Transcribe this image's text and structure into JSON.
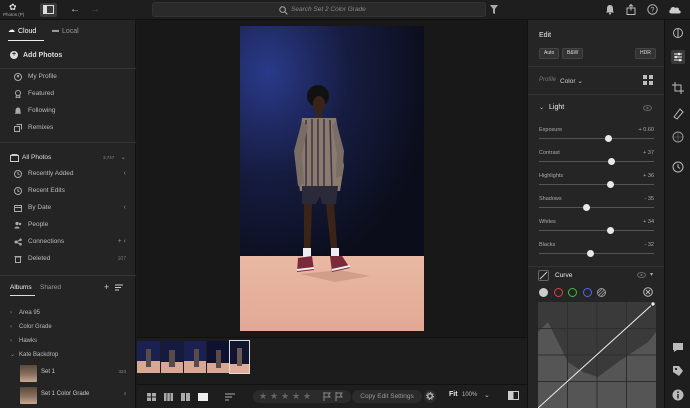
{
  "app": {
    "name": "Photos (P)"
  },
  "search": {
    "placeholder": "Search Set 2 Color Grade"
  },
  "sidebar": {
    "tabs": [
      {
        "label": "Cloud"
      },
      {
        "label": "Local"
      }
    ],
    "add_photos": "Add Photos",
    "profile_items": [
      {
        "label": "My Profile",
        "icon": "user-icon"
      },
      {
        "label": "Featured",
        "icon": "badge-icon"
      },
      {
        "label": "Following",
        "icon": "bell-icon"
      },
      {
        "label": "Remixes",
        "icon": "remix-icon"
      }
    ],
    "all_photos": {
      "label": "All Photos",
      "count": "3,747"
    },
    "photo_items": [
      {
        "label": "Recently Added",
        "icon": "clock-icon",
        "chevron": "‹"
      },
      {
        "label": "Recent Edits",
        "icon": "clock-icon",
        "chevron": ""
      },
      {
        "label": "By Date",
        "icon": "calendar-icon",
        "chevron": "‹"
      },
      {
        "label": "People",
        "icon": "people-icon",
        "chevron": ""
      },
      {
        "label": "Connections",
        "icon": "connections-icon",
        "chevron": "+ ‹"
      },
      {
        "label": "Deleted",
        "icon": "trash-icon",
        "chevron": "",
        "count": "107"
      }
    ],
    "albums_tabs": [
      {
        "label": "Albums"
      },
      {
        "label": "Shared"
      }
    ],
    "albums": [
      {
        "label": "Area 95"
      },
      {
        "label": "Color Grade"
      },
      {
        "label": "Hawks"
      },
      {
        "label": "Kate Backdrop"
      }
    ],
    "album_items": [
      {
        "label": "Set 1",
        "count": "323"
      },
      {
        "label": "Set 1 Color Grade",
        "count": "4"
      }
    ]
  },
  "bottombar": {
    "copy_edit": "Copy Edit Settings",
    "fit": "Fit",
    "zoom": "100%"
  },
  "edit": {
    "title": "Edit",
    "chips": [
      {
        "label": "Auto"
      },
      {
        "label": "B&W"
      },
      {
        "label": "HDR"
      }
    ],
    "profile_label": "Profile",
    "profile_value": "Color",
    "light": {
      "title": "Light",
      "sliders": [
        {
          "label": "Exposure",
          "value": "+ 0.60",
          "level": 0.6
        },
        {
          "label": "Contrast",
          "value": "+ 37",
          "level": 0.63
        },
        {
          "label": "Highlights",
          "value": "+ 36",
          "level": 0.62
        },
        {
          "label": "Shadows",
          "value": "- 35",
          "level": 0.41
        },
        {
          "label": "Whites",
          "value": "+ 34",
          "level": 0.62
        },
        {
          "label": "Blacks",
          "value": "- 32",
          "level": 0.45
        }
      ]
    },
    "curve": {
      "title": "Curve"
    }
  },
  "colors": {
    "accent": "#e8e8e8",
    "channel_red": "#e04040",
    "channel_green": "#3cc33c",
    "channel_blue": "#4a6cf0"
  }
}
